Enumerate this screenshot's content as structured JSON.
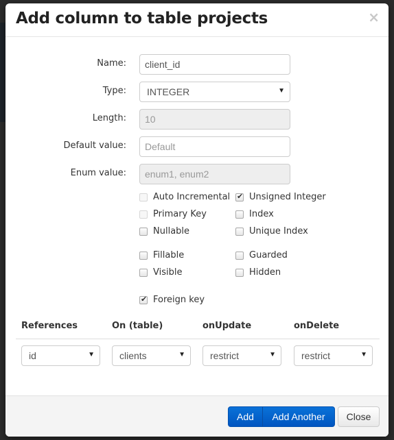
{
  "modal": {
    "title": "Add column to table projects",
    "close_icon": "×"
  },
  "form": {
    "name": {
      "label": "Name:",
      "value": "client_id"
    },
    "type": {
      "label": "Type:",
      "value": "INTEGER"
    },
    "length": {
      "label": "Length:",
      "value": "10"
    },
    "default_value": {
      "label": "Default value:",
      "placeholder": "Default"
    },
    "enum_value": {
      "label": "Enum value:",
      "placeholder": "enum1, enum2"
    }
  },
  "checkboxes": [
    {
      "label": "Auto Incremental",
      "checked": false,
      "disabled": true
    },
    {
      "label": "Unsigned Integer",
      "checked": true,
      "disabled": false
    },
    {
      "label": "Primary Key",
      "checked": false,
      "disabled": true
    },
    {
      "label": "Index",
      "checked": false,
      "disabled": false
    },
    {
      "label": "Nullable",
      "checked": false,
      "disabled": false
    },
    {
      "label": "Unique Index",
      "checked": false,
      "disabled": false
    },
    {
      "label": "Fillable",
      "checked": false,
      "disabled": false
    },
    {
      "label": "Guarded",
      "checked": false,
      "disabled": false
    },
    {
      "label": "Visible",
      "checked": false,
      "disabled": false
    },
    {
      "label": "Hidden",
      "checked": false,
      "disabled": false
    },
    {
      "label": "Foreign key",
      "checked": true,
      "disabled": false
    }
  ],
  "foreign_key": {
    "headers": [
      "References",
      "On (table)",
      "onUpdate",
      "onDelete"
    ],
    "values": [
      "id",
      "clients",
      "restrict",
      "restrict"
    ]
  },
  "footer": {
    "add_label": "Add",
    "add_another_label": "Add Another",
    "close_label": "Close"
  },
  "icons": {
    "caret": "▼"
  }
}
